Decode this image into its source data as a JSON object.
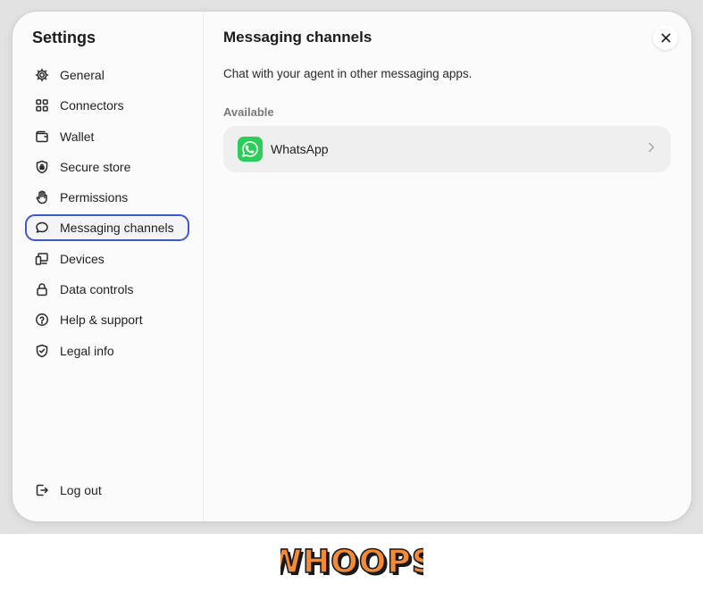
{
  "sidebar": {
    "title": "Settings",
    "items": [
      {
        "label": "General",
        "icon": "gear-icon"
      },
      {
        "label": "Connectors",
        "icon": "grid-icon"
      },
      {
        "label": "Wallet",
        "icon": "wallet-icon"
      },
      {
        "label": "Secure store",
        "icon": "shield-lock-icon"
      },
      {
        "label": "Permissions",
        "icon": "hand-icon"
      },
      {
        "label": "Messaging channels",
        "icon": "chat-bubble-icon",
        "active": true
      },
      {
        "label": "Devices",
        "icon": "devices-icon"
      },
      {
        "label": "Data controls",
        "icon": "lock-icon"
      },
      {
        "label": "Help & support",
        "icon": "question-circle-icon"
      },
      {
        "label": "Legal info",
        "icon": "shield-check-icon"
      }
    ],
    "logout_label": "Log out"
  },
  "main": {
    "title": "Messaging channels",
    "description": "Chat with your agent in other messaging apps.",
    "section_label": "Available",
    "channels": [
      {
        "name": "WhatsApp",
        "icon": "whatsapp-icon"
      }
    ]
  },
  "footer": {
    "logo_text": "WHOOPS"
  },
  "colors": {
    "active_outline": "#3e5cc0",
    "whatsapp_green": "#2ecc5a",
    "whoops_fill": "#f28a3a"
  }
}
